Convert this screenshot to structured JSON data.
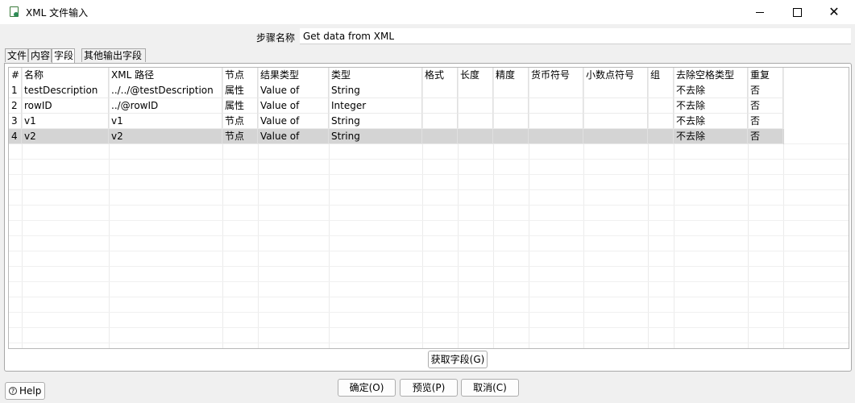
{
  "window": {
    "title": "XML 文件输入"
  },
  "step": {
    "label": "步骤名称",
    "value": "Get data from XML"
  },
  "tabs": [
    {
      "label": "文件"
    },
    {
      "label": "内容"
    },
    {
      "label": "字段"
    },
    {
      "label": "其他输出字段"
    }
  ],
  "active_tab": "字段",
  "table": {
    "columns": [
      "#",
      "名称",
      "XML 路径",
      "节点",
      "结果类型",
      "类型",
      "格式",
      "长度",
      "精度",
      "货币符号",
      "小数点符号",
      "组",
      "去除空格类型",
      "重复"
    ],
    "rows": [
      {
        "num": "1",
        "name": "testDescription",
        "path": "../../@testDescription",
        "node": "属性",
        "result_type": "Value of",
        "type": "String",
        "format": "",
        "length": "",
        "precision": "",
        "currency": "",
        "decimal": "",
        "group": "",
        "trim": "不去除",
        "repeat": "否"
      },
      {
        "num": "2",
        "name": "rowID",
        "path": "../@rowID",
        "node": "属性",
        "result_type": "Value of",
        "type": "Integer",
        "format": "",
        "length": "",
        "precision": "",
        "currency": "",
        "decimal": "",
        "group": "",
        "trim": "不去除",
        "repeat": "否"
      },
      {
        "num": "3",
        "name": "v1",
        "path": "v1",
        "node": "节点",
        "result_type": "Value of",
        "type": "String",
        "format": "",
        "length": "",
        "precision": "",
        "currency": "",
        "decimal": "",
        "group": "",
        "trim": "不去除",
        "repeat": "否"
      },
      {
        "num": "4",
        "name": "v2",
        "path": "v2",
        "node": "节点",
        "result_type": "Value of",
        "type": "String",
        "format": "",
        "length": "",
        "precision": "",
        "currency": "",
        "decimal": "",
        "group": "",
        "trim": "不去除",
        "repeat": "否"
      }
    ],
    "selected_row": 4
  },
  "buttons": {
    "get_fields": "获取字段(G)",
    "ok": "确定(O)",
    "preview": "预览(P)",
    "cancel": "取消(C)",
    "help": "Help"
  },
  "icons": {
    "app": "spoon-xml-file-icon",
    "help": "question-circle-icon"
  },
  "colors": {
    "selected_row": "#d4d4d4",
    "window_bg": "#f0f0f0"
  }
}
